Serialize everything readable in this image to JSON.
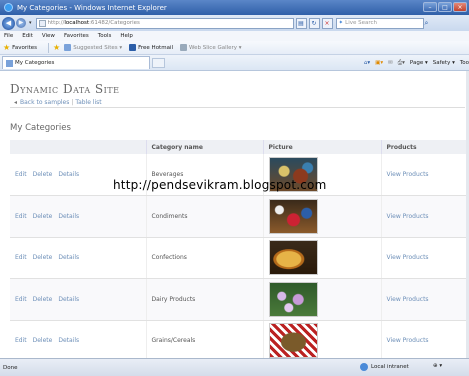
{
  "window": {
    "title": "My Categories - Windows Internet Explorer"
  },
  "address_bar": {
    "url_prefix": "http://",
    "url_host": "localhost",
    "url_rest": ":61482/Categories",
    "search_placeholder": "Live Search"
  },
  "menu": [
    "File",
    "Edit",
    "View",
    "Favorites",
    "Tools",
    "Help"
  ],
  "favorites_bar": {
    "favorites_label": "Favorites",
    "items": [
      "Suggested Sites ▾",
      "Free Hotmail",
      "Web Slice Gallery ▾"
    ]
  },
  "tab": {
    "label": "My Categories"
  },
  "command_bar": {
    "page": "Page ▾",
    "safety": "Safety ▾",
    "tools": "Too"
  },
  "page": {
    "site_title": "Dynamic Data Site",
    "back_link": "Back to samples",
    "separator": "|",
    "table_link": "Table list",
    "heading": "My Categories",
    "columns": [
      "",
      "Category name",
      "Picture",
      "Products"
    ],
    "row_actions": [
      "Edit",
      "Delete",
      "Details"
    ],
    "view_products_label": "View Products",
    "rows": [
      {
        "name": "Beverages"
      },
      {
        "name": "Condiments"
      },
      {
        "name": "Confections"
      },
      {
        "name": "Dairy Products"
      },
      {
        "name": "Grains/Cereals"
      }
    ]
  },
  "watermark": "http://pendsevikram.blogspot.com",
  "status_bar": {
    "left": "Done",
    "zone": "Local intranet",
    "zoom": "⊕ ▾"
  }
}
